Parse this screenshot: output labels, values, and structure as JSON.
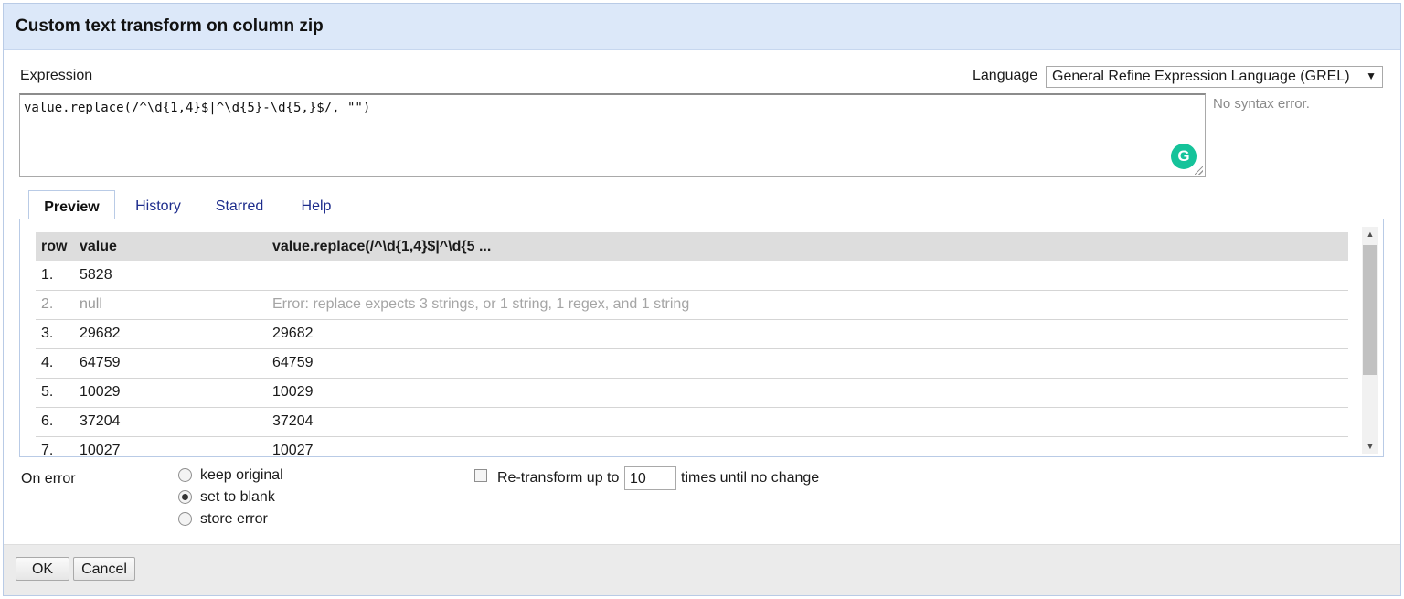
{
  "dialog": {
    "title": "Custom text transform on column zip"
  },
  "expression": {
    "label": "Expression",
    "value": "value.replace(/^\\d{1,4}$|^\\d{5}-\\d{5,}$/, \"\")",
    "syntax_status": "No syntax error."
  },
  "language": {
    "label": "Language",
    "selected": "General Refine Expression Language (GREL)",
    "arrow": "▼"
  },
  "grammarly": {
    "glyph": "G",
    "icon": "grammarly-icon"
  },
  "tabs": [
    {
      "label": "Preview",
      "active": true
    },
    {
      "label": "History",
      "active": false
    },
    {
      "label": "Starred",
      "active": false
    },
    {
      "label": "Help",
      "active": false
    }
  ],
  "preview": {
    "columns": [
      "row",
      "value",
      "value.replace(/^\\d{1,4}$|^\\d{5 ..."
    ],
    "rows": [
      {
        "row": "1.",
        "value": "5828",
        "result": ""
      },
      {
        "row": "2.",
        "value": "null",
        "result": "Error: replace expects 3 strings, or 1 string, 1 regex, and 1 string"
      },
      {
        "row": "3.",
        "value": "29682",
        "result": "29682"
      },
      {
        "row": "4.",
        "value": "64759",
        "result": "64759"
      },
      {
        "row": "5.",
        "value": "10029",
        "result": "10029"
      },
      {
        "row": "6.",
        "value": "37204",
        "result": "37204"
      },
      {
        "row": "7.",
        "value": "10027",
        "result": "10027"
      }
    ],
    "scroll_up": "▲",
    "scroll_down": "▼"
  },
  "on_error": {
    "label": "On error",
    "options": [
      {
        "label": "keep original",
        "checked": false
      },
      {
        "label": "set to blank",
        "checked": true
      },
      {
        "label": "store error",
        "checked": false
      }
    ]
  },
  "retransform": {
    "checked": false,
    "label": "Re-transform up to",
    "times_value": "10",
    "suffix": "times until no change"
  },
  "buttons": {
    "ok": "OK",
    "cancel": "Cancel"
  }
}
